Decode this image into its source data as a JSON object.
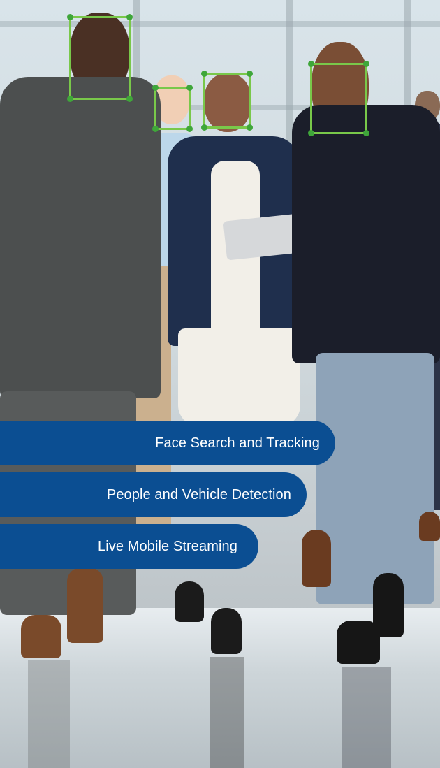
{
  "features": [
    {
      "label": "Face Search and Tracking"
    },
    {
      "label": "People and Vehicle Detection"
    },
    {
      "label": "Live Mobile Streaming"
    }
  ],
  "colors": {
    "pill_background": "#0b4e92",
    "pill_text": "#ffffff",
    "face_box": "#79c84a",
    "face_box_corner": "#3fa63a"
  },
  "face_detections_count": 4
}
